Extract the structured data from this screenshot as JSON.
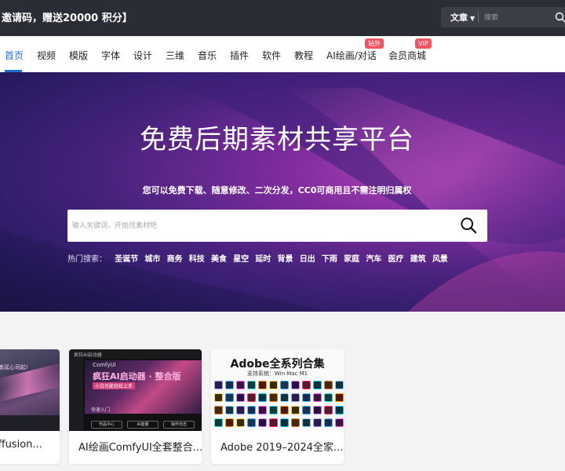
{
  "topbar": {
    "promo_text": "邀请码，赠送20000 积分】",
    "search_select": "文章",
    "search_placeholder": "搜索"
  },
  "nav": {
    "items": [
      {
        "label": "首页",
        "active": true
      },
      {
        "label": "视频"
      },
      {
        "label": "模版"
      },
      {
        "label": "字体"
      },
      {
        "label": "设计"
      },
      {
        "label": "三维"
      },
      {
        "label": "音乐"
      },
      {
        "label": "插件"
      },
      {
        "label": "软件"
      },
      {
        "label": "教程"
      },
      {
        "label": "AI绘画/对话",
        "badge": "站外"
      },
      {
        "label": "会员商城",
        "badge": "VIP"
      }
    ]
  },
  "hero": {
    "title": "免费后期素材共享平台",
    "subtitle": "您可以免费下载、随意修改、二次分发，CC0可商用且不需注明归属权",
    "search_placeholder": "输入关键词，开始找素材吧",
    "hot_label": "热门搜索：",
    "hot_tags": [
      "圣诞节",
      "城市",
      "商务",
      "科技",
      "美食",
      "星空",
      "延时",
      "背景",
      "日出",
      "下雨",
      "家庭",
      "汽车",
      "医疗",
      "建筑",
      "风景"
    ]
  },
  "cards": [
    {
      "title": "iffusion...",
      "thumb_text": "笔延心司起!"
    },
    {
      "title": "AI绘画ComfyUI全套整合...",
      "thumb_top": "疯狂Ai启动器",
      "thumb_small": "ComfyUI",
      "thumb_heading": "疯狂AI启动器 · 整合版",
      "thumb_badge": "小白也能轻松上手",
      "thumb_row": "快速入门",
      "thumb_btn1": "作品中心",
      "thumb_btn2": "AI能量",
      "thumb_btn3": "操作日志"
    },
    {
      "title": "Adobe 2019–2024全家...",
      "thumb_heading": "Adobe全系列合集",
      "thumb_sub": "支持系统：Win Mac M1"
    }
  ],
  "colors": {
    "topbar_bg": "#2b2d36",
    "accent": "#1e6fd9",
    "badge": "#f05561"
  }
}
